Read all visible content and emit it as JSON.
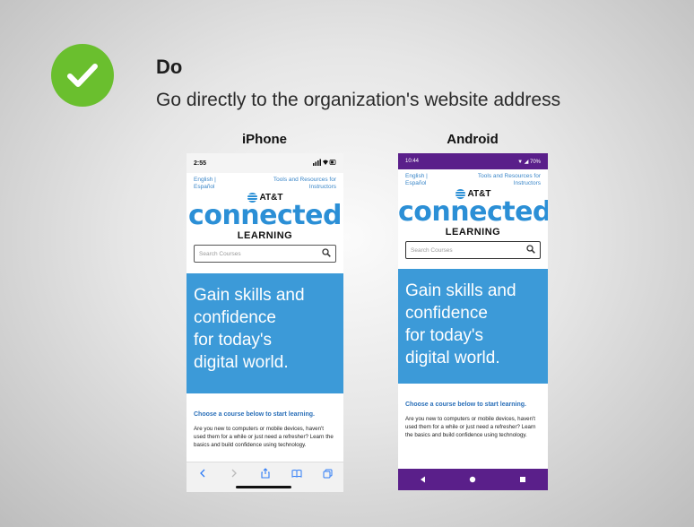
{
  "slide": {
    "heading": "Do",
    "subheading": "Go directly to the organization's website address",
    "check_color": "#6abf2e"
  },
  "iphone": {
    "label": "iPhone",
    "status_time": "2:55",
    "status_icons": "▯▯▯ ◔ ■",
    "link_left_1": "English |",
    "link_left_2": "Español",
    "link_right_1": "Tools and Resources for",
    "link_right_2": "Instructors",
    "brand_att": "AT&T",
    "brand_connected": "connected",
    "brand_learning": "LEARNING",
    "search_placeholder": "Search Courses",
    "hero_text_1": "Gain skills and",
    "hero_text_2": "confidence",
    "hero_text_3": "for today's",
    "hero_text_4": "digital world.",
    "intro_title": "Choose a course below to start learning.",
    "intro_text": "Are you new to computers or mobile devices, haven't used them for a while or just need a refresher? Learn the basics and build confidence using technology."
  },
  "android": {
    "label": "Android",
    "status_time": "10:44",
    "status_icons": "▼ ◢ 70%",
    "link_left_1": "English |",
    "link_left_2": "Español",
    "link_right_1": "Tools and Resources for",
    "link_right_2": "Instructors",
    "brand_att": "AT&T",
    "brand_connected": "connected",
    "brand_learning": "LEARNING",
    "search_placeholder": "Search Courses",
    "hero_text_1": "Gain skills and",
    "hero_text_2": "confidence",
    "hero_text_3": "for today's",
    "hero_text_4": "digital world.",
    "intro_title": "Choose a course below to start learning.",
    "intro_text": "Are you new to computers or mobile devices, haven't used them for a while or just need a refresher? Learn the basics and build confidence using technology."
  },
  "colors": {
    "brand_blue": "#2b8fd6",
    "hero_blue": "#3c9ad8",
    "android_purple": "#5a1f8a"
  }
}
